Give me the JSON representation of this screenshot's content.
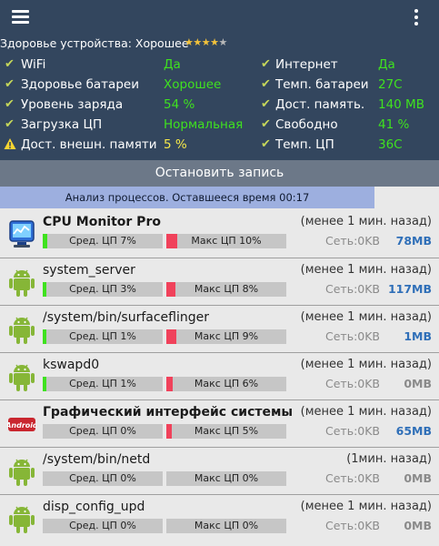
{
  "health": {
    "text": "Здоровье устройства: Хорошее",
    "rating": 4,
    "max_rating": 5
  },
  "status_rows": [
    {
      "icon": "check",
      "left_label": "WiFi",
      "left_value": "Да",
      "right_label": "Интернет",
      "right_value": "Да"
    },
    {
      "icon": "check",
      "left_label": "Здоровье батареи",
      "left_value": "Хорошее",
      "right_label": "Темп. батареи",
      "right_value": "27C"
    },
    {
      "icon": "check",
      "left_label": "Уровень заряда",
      "left_value": "54 %",
      "right_label": "Дост. память.",
      "right_value": "140 MB"
    },
    {
      "icon": "check",
      "left_label": "Загрузка ЦП",
      "left_value": "Нормальная",
      "right_label": "Свободно",
      "right_value": "41 %"
    },
    {
      "icon": "warning",
      "left_label": "Дост. внешн. памяти",
      "left_value": "5 %",
      "right_label": "Темп. ЦП",
      "right_value": "36C"
    }
  ],
  "stop_button": "Остановить запись",
  "analysis_text": "Анализ процессов. Оставшееся время 00:17",
  "processes": [
    {
      "name": "CPU Monitor Pro",
      "bold": true,
      "icon": "cpu-monitor-pro-icon",
      "time": "(менее 1 мин. назад)",
      "avg_label": "Сред. ЦП 7%",
      "avg": 7,
      "max_label": "Макс ЦП 10%",
      "max": 10,
      "net": "Сеть:0KB",
      "mem": "78MB",
      "mem_color": "#2f6fb8"
    },
    {
      "name": "system_server",
      "bold": false,
      "icon": "android-icon",
      "time": "(менее 1 мин. назад)",
      "avg_label": "Сред. ЦП 3%",
      "avg": 3,
      "max_label": "Макс ЦП 8%",
      "max": 8,
      "net": "Сеть:0KB",
      "mem": "117MB",
      "mem_color": "#2f6fb8"
    },
    {
      "name": "/system/bin/surfaceflinger",
      "bold": false,
      "icon": "android-icon",
      "time": "(менее 1 мин. назад)",
      "avg_label": "Сред. ЦП 1%",
      "avg": 1,
      "max_label": "Макс ЦП 9%",
      "max": 9,
      "net": "Сеть:0KB",
      "mem": "1MB",
      "mem_color": "#2f6fb8"
    },
    {
      "name": "kswapd0",
      "bold": false,
      "icon": "android-icon",
      "time": "(менее 1 мин. назад)",
      "avg_label": "Сред. ЦП 1%",
      "avg": 1,
      "max_label": "Макс ЦП 6%",
      "max": 6,
      "net": "Сеть:0KB",
      "mem": "0MB",
      "mem_color": "#8a8a8a"
    },
    {
      "name": "Графический интерфейс системы",
      "bold": true,
      "icon": "android-kitkat-icon",
      "time": "(менее 1 мин. назад)",
      "avg_label": "Сред. ЦП 0%",
      "avg": 0,
      "max_label": "Макс ЦП 5%",
      "max": 5,
      "net": "Сеть:0KB",
      "mem": "65MB",
      "mem_color": "#2f6fb8"
    },
    {
      "name": "/system/bin/netd",
      "bold": false,
      "icon": "android-icon",
      "time": "(1мин. назад)",
      "avg_label": "Сред. ЦП 0%",
      "avg": 0,
      "max_label": "Макс ЦП 0%",
      "max": 0,
      "net": "Сеть:0KB",
      "mem": "0MB",
      "mem_color": "#8a8a8a"
    },
    {
      "name": "disp_config_upd",
      "bold": false,
      "icon": "android-icon",
      "time": "(менее 1 мин. назад)",
      "avg_label": "Сред. ЦП 0%",
      "avg": 0,
      "max_label": "Макс ЦП 0%",
      "max": 0,
      "net": "Сеть:0KB",
      "mem": "0MB",
      "mem_color": "#8a8a8a"
    }
  ],
  "colors": {
    "header_bg": "#33465e",
    "status_value": "#3fe21f",
    "warning_value": "#f6e94a",
    "avg_bar": "#3fe21f",
    "max_bar": "#f0425b",
    "analysis_bg": "#9dafdf"
  }
}
